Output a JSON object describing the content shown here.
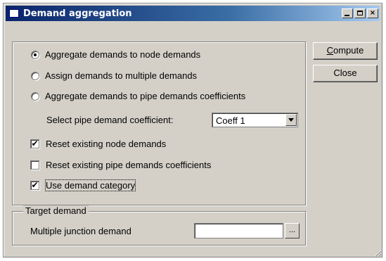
{
  "window": {
    "title": "Demand aggregation",
    "controls": {
      "minimize": "_",
      "maximize": "□",
      "close": "×"
    }
  },
  "options": {
    "radio": [
      {
        "label": "Aggregate demands to node demands",
        "checked": true
      },
      {
        "label": "Assign demands to multiple demands",
        "checked": false
      },
      {
        "label": "Aggregate demands to pipe demands coefficients",
        "checked": false
      }
    ],
    "coefficient_label": "Select pipe demand coefficient:",
    "coefficient_value": "Coeff 1",
    "checkboxes": [
      {
        "label": "Reset existing node demands",
        "checked": true
      },
      {
        "label": "Reset existing pipe demands coefficients",
        "checked": false
      },
      {
        "label": "Use demand category",
        "checked": true
      }
    ],
    "check_mark": "✔"
  },
  "buttons": {
    "compute": {
      "prefix": "",
      "accel": "C",
      "rest": "ompute"
    },
    "close": "Close"
  },
  "target": {
    "group_label": "Target demand",
    "field_label": "Multiple junction demand",
    "field_value": "",
    "browse_label": "..."
  }
}
